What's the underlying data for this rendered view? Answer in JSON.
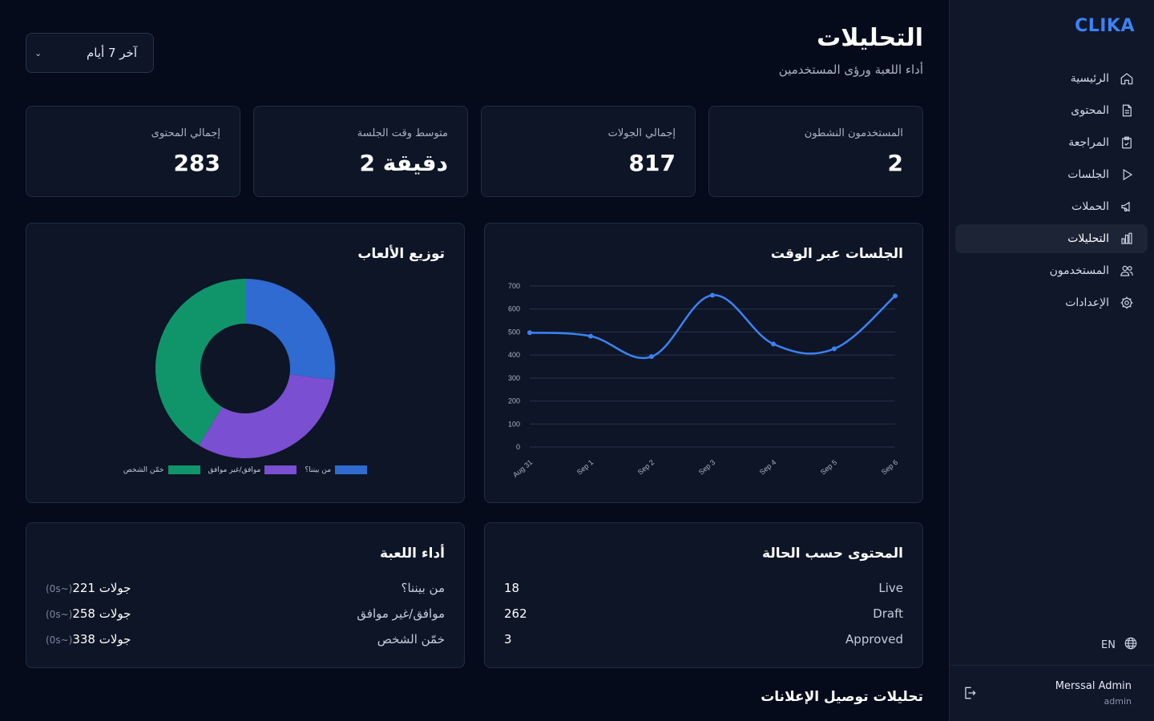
{
  "brand": "CLIKA",
  "sidebar": {
    "items": [
      {
        "label": "الرئيسية",
        "icon": "home-icon",
        "active": false
      },
      {
        "label": "المحتوى",
        "icon": "document-icon",
        "active": false
      },
      {
        "label": "المراجعة",
        "icon": "clipboard-check-icon",
        "active": false
      },
      {
        "label": "الجلسات",
        "icon": "play-icon",
        "active": false
      },
      {
        "label": "الحملات",
        "icon": "megaphone-icon",
        "active": false
      },
      {
        "label": "التحليلات",
        "icon": "bar-chart-icon",
        "active": true
      },
      {
        "label": "المستخدمون",
        "icon": "users-icon",
        "active": false
      },
      {
        "label": "الإعدادات",
        "icon": "gear-icon",
        "active": false
      }
    ],
    "language": "EN",
    "user": {
      "name": "Merssal Admin",
      "role": "admin"
    }
  },
  "header": {
    "title": "التحليلات",
    "subtitle": "أداء اللعبة ورؤى المستخدمين",
    "range": "آخر 7 أيام"
  },
  "stats": [
    {
      "label": "المستخدمون النشطون",
      "value": "2"
    },
    {
      "label": "إجمالي الجولات",
      "value": "817"
    },
    {
      "label": "متوسط وقت الجلسة",
      "value": "2 دقيقة"
    },
    {
      "label": "إجمالي المحتوى",
      "value": "283"
    }
  ],
  "sessions_chart": {
    "title": "الجلسات عبر الوقت"
  },
  "games_chart": {
    "title": "توزيع الألعاب"
  },
  "chart_data": [
    {
      "type": "line",
      "title": "الجلسات عبر الوقت",
      "x": [
        "Aug 31",
        "Sep 1",
        "Sep 2",
        "Sep 3",
        "Sep 4",
        "Sep 5",
        "Sep 6"
      ],
      "series": [
        {
          "values": [
            497,
            482,
            393,
            660,
            448,
            427,
            657
          ]
        }
      ],
      "ylim": [
        0,
        700
      ],
      "yticks": [
        0,
        100,
        200,
        300,
        400,
        500,
        600,
        700
      ],
      "grid": true,
      "color": "#3b82f6"
    },
    {
      "type": "pie",
      "title": "توزيع الألعاب",
      "categories": [
        "من بيننا؟",
        "موافق/غير موافق",
        "خمّن الشخص"
      ],
      "values": [
        221,
        258,
        338
      ],
      "colors": [
        "#2f6bd0",
        "#7a4fd1",
        "#10956a"
      ],
      "donut": true,
      "legend": "bottom"
    }
  ],
  "performance": {
    "title": "أداء اللعبة",
    "rows": [
      {
        "label": "من بيننا؟",
        "value": "221 جولات",
        "suffix": "(0s~)"
      },
      {
        "label": "موافق/غير موافق",
        "value": "258 جولات",
        "suffix": "(0s~)"
      },
      {
        "label": "خمّن الشخص",
        "value": "338 جولات",
        "suffix": "(0s~)"
      }
    ]
  },
  "content_status": {
    "title": "المحتوى حسب الحالة",
    "rows": [
      {
        "label": "Live",
        "value": "18"
      },
      {
        "label": "Draft",
        "value": "262"
      },
      {
        "label": "Approved",
        "value": "3"
      }
    ]
  },
  "ads_section": {
    "title": "تحليلات توصيل الإعلانات"
  }
}
